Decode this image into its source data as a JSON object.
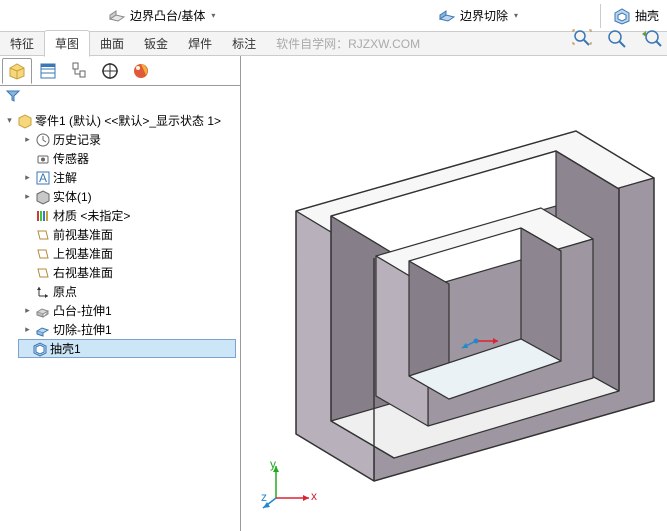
{
  "toolbar": {
    "btn1": "边界凸台/基体",
    "btn2": "边界切除",
    "btn3": "抽壳"
  },
  "tabs": {
    "t1": "特征",
    "t2": "草图",
    "t3": "曲面",
    "t4": "钣金",
    "t5": "焊件",
    "t6": "标注"
  },
  "watermark": "软件自学网：RJZXW.COM",
  "tree": {
    "root": "零件1 (默认) <<默认>_显示状态 1>",
    "history": "历史记录",
    "sensors": "传感器",
    "annotations": "注解",
    "solid": "实体(1)",
    "material": "材质 <未指定>",
    "front": "前视基准面",
    "top": "上视基准面",
    "right": "右视基准面",
    "origin": "原点",
    "extrude1": "凸台-拉伸1",
    "cut1": "切除-拉伸1",
    "shell1": "抽壳1"
  },
  "triad": {
    "x": "x",
    "y": "y",
    "z": "z"
  }
}
